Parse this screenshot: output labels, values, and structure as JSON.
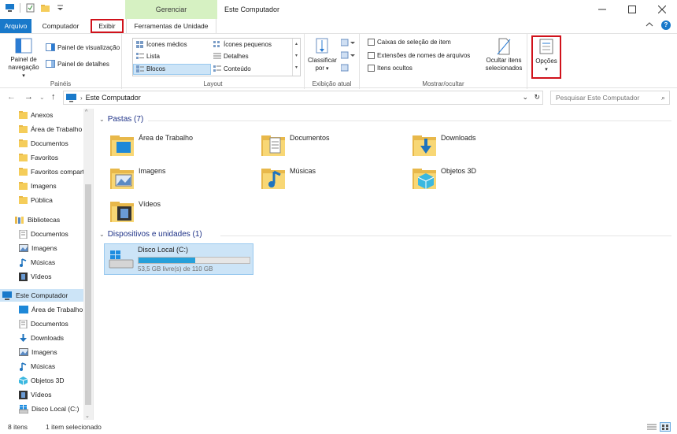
{
  "window": {
    "title": "Este Computador",
    "context_tab": "Gerenciar"
  },
  "tabs": {
    "arquivo": "Arquivo",
    "computador": "Computador",
    "exibir": "Exibir",
    "ferramentas": "Ferramentas de Unidade"
  },
  "ribbon": {
    "paineis": {
      "painel_navegacao": "Painel de navegação",
      "visualizacao": "Painel de visualização",
      "detalhes": "Painel de detalhes",
      "label": "Painéis"
    },
    "layout": {
      "icones_medios": "Ícones médios",
      "icones_pequenos": "Ícones pequenos",
      "lista": "Lista",
      "detalhes": "Detalhes",
      "blocos": "Blocos",
      "conteudo": "Conteúdo",
      "label": "Layout"
    },
    "exibicao": {
      "classificar": "Classificar",
      "por": "por",
      "label": "Exibição atual"
    },
    "mostrar": {
      "caixas": "Caixas de seleção de item",
      "extensoes": "Extensões de nomes de arquivos",
      "ocultos": "Itens ocultos",
      "ocultar_line1": "Ocultar itens",
      "ocultar_line2": "selecionados",
      "label": "Mostrar/ocultar"
    },
    "opcoes": "Opções"
  },
  "address": {
    "path": "Este Computador",
    "search_placeholder": "Pesquisar Este Computador"
  },
  "nav": {
    "items": [
      {
        "label": "Anexos",
        "icon": "folder-icon"
      },
      {
        "label": "Área de Trabalho",
        "icon": "folder-icon"
      },
      {
        "label": "Documentos",
        "icon": "folder-icon"
      },
      {
        "label": "Favoritos",
        "icon": "folder-icon"
      },
      {
        "label": "Favoritos compartilhados",
        "icon": "folder-icon"
      },
      {
        "label": "Imagens",
        "icon": "folder-icon"
      },
      {
        "label": "Pública",
        "icon": "folder-icon"
      },
      {
        "label": "Bibliotecas",
        "icon": "libraries-icon"
      },
      {
        "label": "Documentos",
        "icon": "documents-icon"
      },
      {
        "label": "Imagens",
        "icon": "pictures-icon"
      },
      {
        "label": "Músicas",
        "icon": "music-icon"
      },
      {
        "label": "Vídeos",
        "icon": "videos-icon"
      },
      {
        "label": "Este Computador",
        "icon": "computer-icon"
      },
      {
        "label": "Área de Trabalho",
        "icon": "desktop-icon"
      },
      {
        "label": "Documentos",
        "icon": "documents-icon"
      },
      {
        "label": "Downloads",
        "icon": "downloads-icon"
      },
      {
        "label": "Imagens",
        "icon": "pictures-icon"
      },
      {
        "label": "Músicas",
        "icon": "music-icon"
      },
      {
        "label": "Objetos 3D",
        "icon": "objects3d-icon"
      },
      {
        "label": "Vídeos",
        "icon": "videos-icon"
      },
      {
        "label": "Disco Local (C:)",
        "icon": "drive-icon"
      }
    ]
  },
  "content": {
    "folders_header": "Pastas (7)",
    "folders": [
      {
        "label": "Área de Trabalho",
        "icon": "desktop-folder-icon"
      },
      {
        "label": "Documentos",
        "icon": "documents-folder-icon"
      },
      {
        "label": "Downloads",
        "icon": "downloads-folder-icon"
      },
      {
        "label": "Imagens",
        "icon": "pictures-folder-icon"
      },
      {
        "label": "Músicas",
        "icon": "music-folder-icon"
      },
      {
        "label": "Objetos 3D",
        "icon": "objects3d-folder-icon"
      },
      {
        "label": "Vídeos",
        "icon": "videos-folder-icon"
      }
    ],
    "devices_header": "Dispositivos e unidades (1)",
    "drive": {
      "name": "Disco Local (C:)",
      "free": "53,5 GB livre(s) de 110 GB",
      "used_fraction": 0.51
    }
  },
  "status": {
    "items": "8 itens",
    "selected": "1 item selecionado"
  },
  "colors": {
    "accent": "#1979ca",
    "highlight": "#d0121b",
    "selection": "#cce4f7",
    "context_tab": "#d6f1c2"
  }
}
